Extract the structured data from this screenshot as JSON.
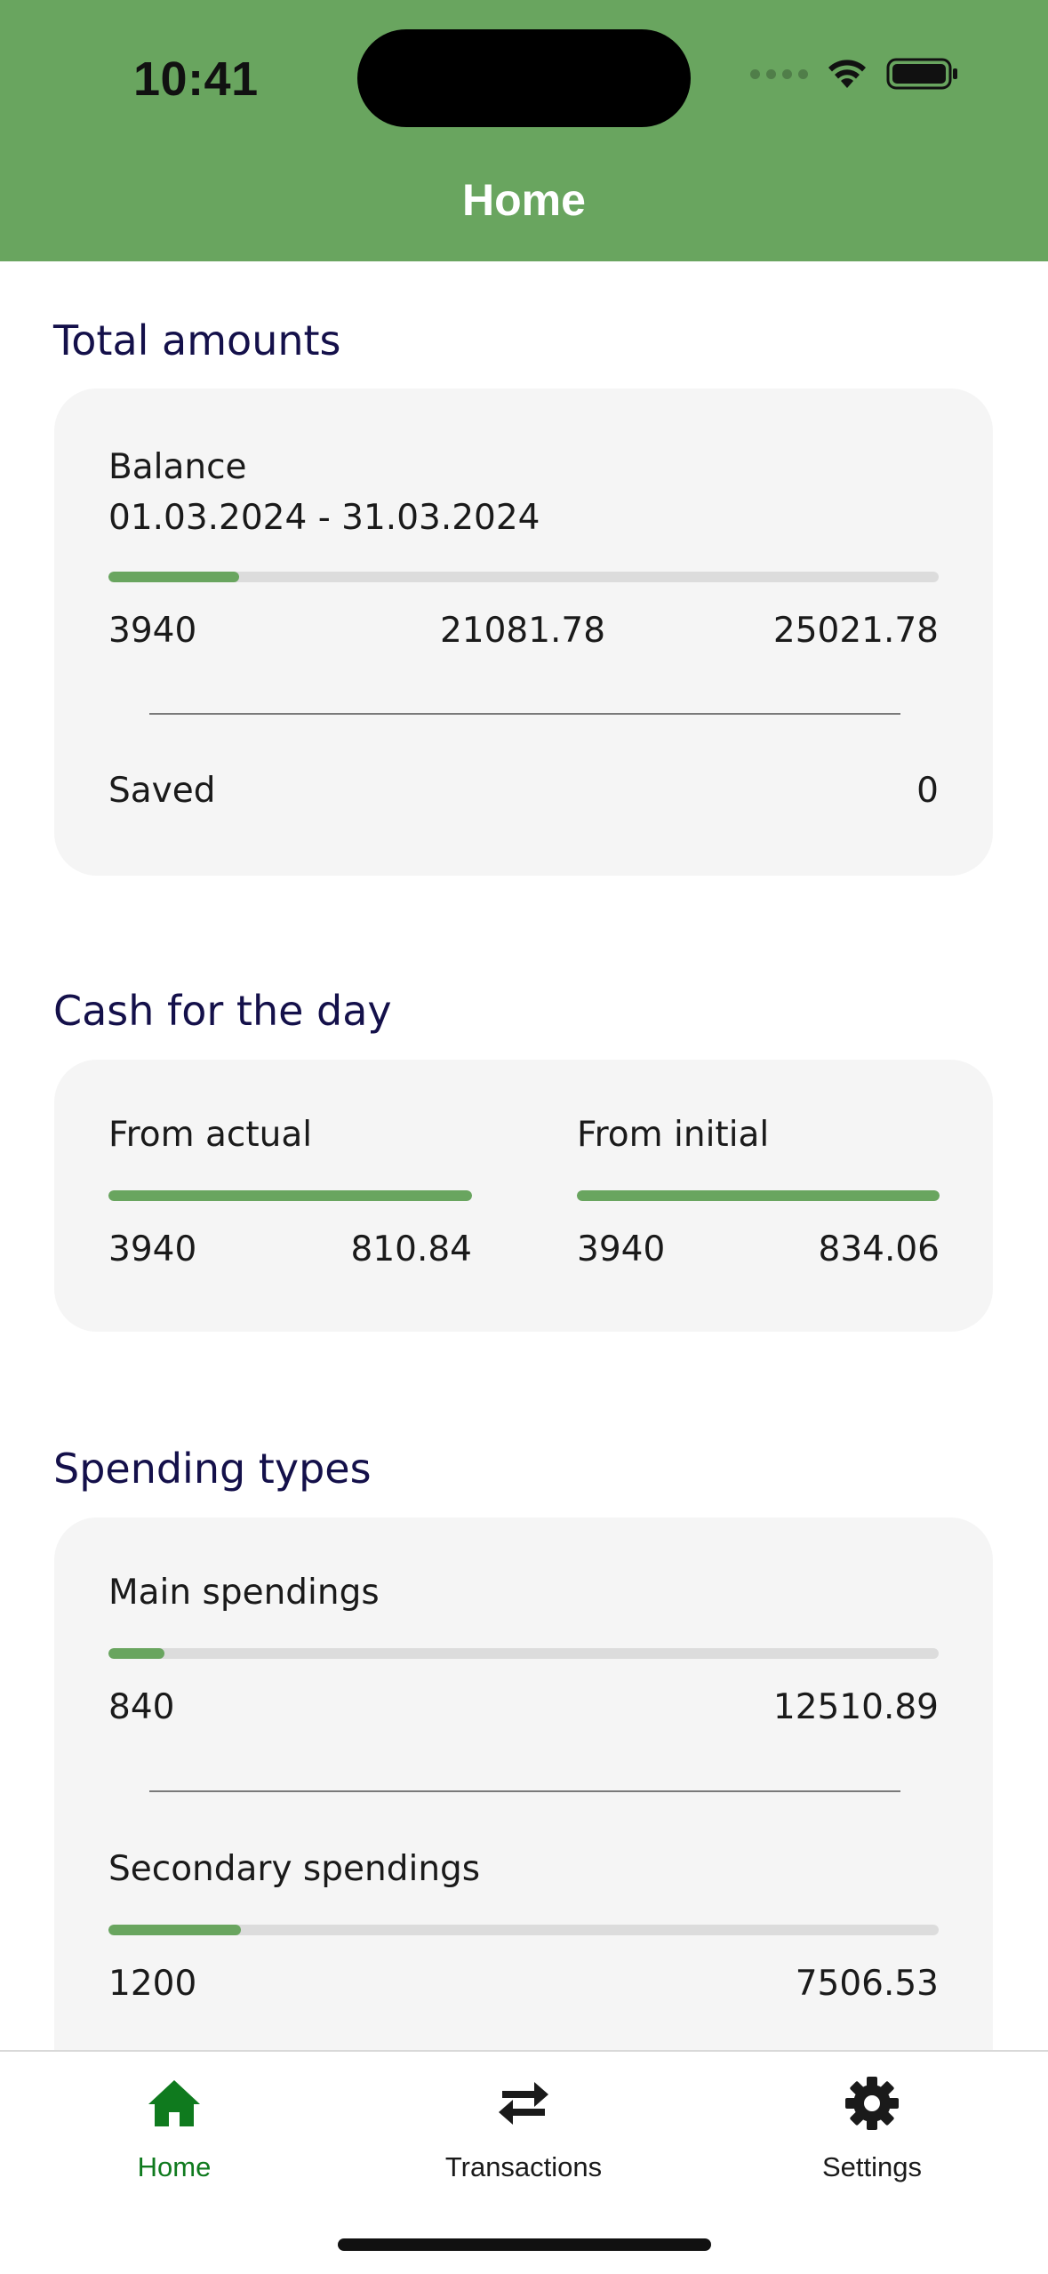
{
  "status_bar": {
    "time": "10:41"
  },
  "header": {
    "title": "Home",
    "color": "#69a55f"
  },
  "total_amounts": {
    "section_title": "Total amounts",
    "balance_label": "Balance",
    "period": "01.03.2024 - 31.03.2024",
    "progress": 0.157,
    "spent": "3940",
    "remaining": "21081.78",
    "total": "25021.78",
    "saved_label": "Saved",
    "saved_value": "0"
  },
  "cash_for_day": {
    "section_title": "Cash for the day",
    "from_actual": {
      "label": "From actual",
      "progress": 1.0,
      "spent": "3940",
      "value": "810.84"
    },
    "from_initial": {
      "label": "From initial",
      "progress": 1.0,
      "spent": "3940",
      "value": "834.06"
    }
  },
  "spending_types": {
    "section_title": "Spending types",
    "items": [
      {
        "label": "Main spendings",
        "progress": 0.067,
        "spent": "840",
        "total": "12510.89"
      },
      {
        "label": "Secondary spendings",
        "progress": 0.16,
        "spent": "1200",
        "total": "7506.53"
      }
    ]
  },
  "bottom_nav": {
    "items": [
      {
        "label": "Home",
        "icon": "home-icon",
        "active": true
      },
      {
        "label": "Transactions",
        "icon": "swap-arrows-icon",
        "active": false
      },
      {
        "label": "Settings",
        "icon": "gear-icon",
        "active": false
      }
    ],
    "active_color": "#0f7a1e"
  }
}
